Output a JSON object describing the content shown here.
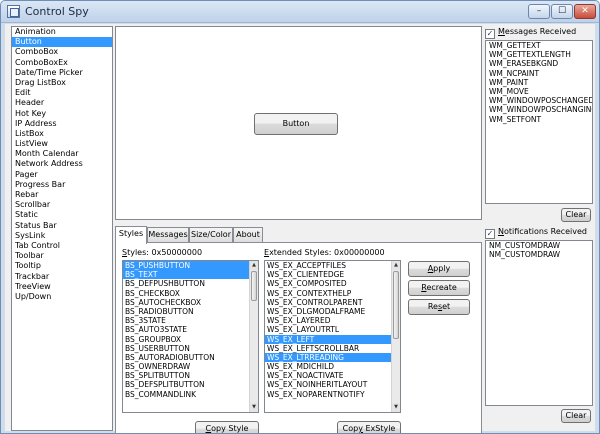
{
  "window": {
    "title": "Control Spy",
    "min_glyph": "–",
    "max_glyph": "☐",
    "close_glyph": "✕"
  },
  "controls": [
    "Animation",
    "Button",
    "ComboBox",
    "ComboBoxEx",
    "Date/Time Picker",
    "Drag ListBox",
    "Edit",
    "Header",
    "Hot Key",
    "IP Address",
    "ListBox",
    "ListView",
    "Month Calendar",
    "Network Address",
    "Pager",
    "Progress Bar",
    "Rebar",
    "Scrollbar",
    "Static",
    "Status Bar",
    "SysLink",
    "Tab Control",
    "Toolbar",
    "Tooltip",
    "Trackbar",
    "TreeView",
    "Up/Down"
  ],
  "selected_control": "Button",
  "demo_button_label": "Button",
  "tabs": [
    {
      "label": "Styles",
      "active": true
    },
    {
      "label": "Messages",
      "active": false
    },
    {
      "label": "Size/Color",
      "active": false
    },
    {
      "label": "About",
      "active": false
    }
  ],
  "styles": {
    "label": "Styles: 0x50000000",
    "items": [
      "BS_PUSHBUTTON",
      "BS_TEXT",
      "BS_DEFPUSHBUTTON",
      "BS_CHECKBOX",
      "BS_AUTOCHECKBOX",
      "BS_RADIOBUTTON",
      "BS_3STATE",
      "BS_AUTO3STATE",
      "BS_GROUPBOX",
      "BS_USERBUTTON",
      "BS_AUTORADIOBUTTON",
      "BS_OWNERDRAW",
      "BS_SPLITBUTTON",
      "BS_DEFSPLITBUTTON",
      "BS_COMMANDLINK"
    ],
    "selected": [
      "BS_PUSHBUTTON",
      "BS_TEXT"
    ],
    "copy_label": "Copy Style"
  },
  "ex_styles": {
    "label": "Extended Styles: 0x00000000",
    "items": [
      "WS_EX_ACCEPTFILES",
      "WS_EX_CLIENTEDGE",
      "WS_EX_COMPOSITED",
      "WS_EX_CONTEXTHELP",
      "WS_EX_CONTROLPARENT",
      "WS_EX_DLGMODALFRAME",
      "WS_EX_LAYERED",
      "WS_EX_LAYOUTRTL",
      "WS_EX_LEFT",
      "WS_EX_LEFTSCROLLBAR",
      "WS_EX_LTRREADING",
      "WS_EX_MDICHILD",
      "WS_EX_NOACTIVATE",
      "WS_EX_NOINHERITLAYOUT",
      "WS_EX_NOPARENTNOTIFY"
    ],
    "selected": [
      "WS_EX_LEFT",
      "WS_EX_LTRREADING"
    ],
    "copy_label": "Copy ExStyle"
  },
  "actions": {
    "apply": "Apply",
    "recreate": "Recreate",
    "reset": "Reset"
  },
  "messages": {
    "label": "Messages Received",
    "checked": true,
    "items": [
      "WM_GETTEXT",
      "WM_GETTEXTLENGTH",
      "WM_ERASEBKGND",
      "WM_NCPAINT",
      "WM_PAINT",
      "WM_MOVE",
      "WM_WINDOWPOSCHANGED",
      "WM_WINDOWPOSCHANGING",
      "WM_SETFONT"
    ],
    "clear_label": "Clear"
  },
  "notifications": {
    "label": "Notifications Received",
    "checked": true,
    "items": [
      "NM_CUSTOMDRAW",
      "NM_CUSTOMDRAW"
    ],
    "clear_label": "Clear"
  }
}
